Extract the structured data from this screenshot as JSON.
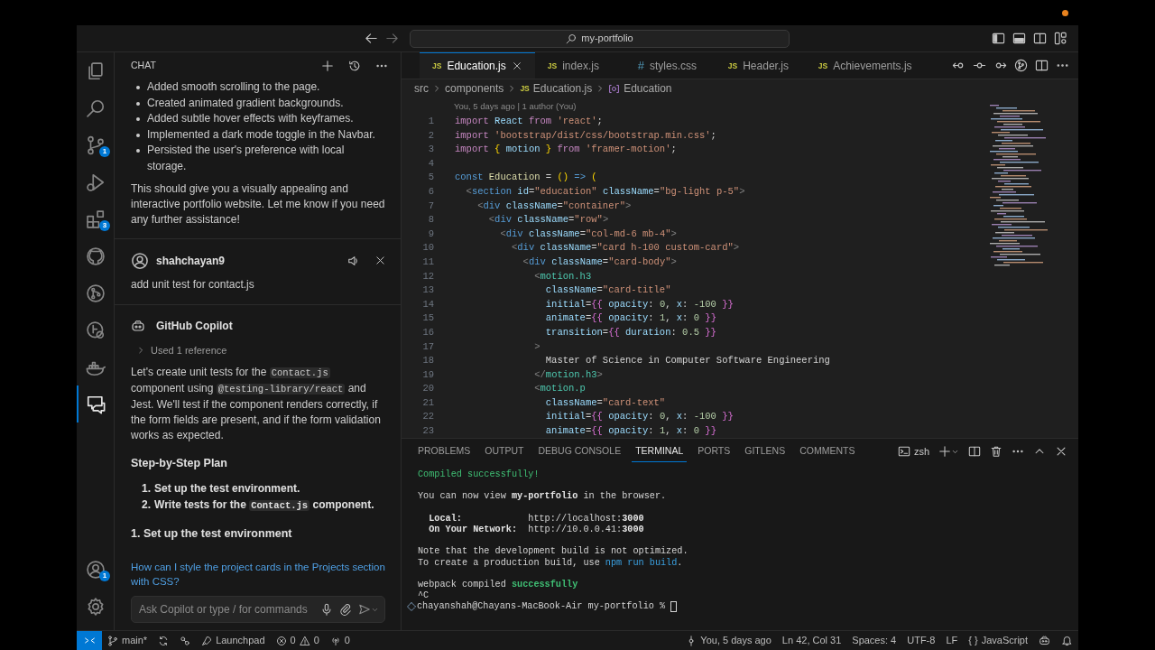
{
  "title_bar": {
    "search": "my-portfolio"
  },
  "activity_bar": {
    "top": [
      {
        "selected": false
      },
      {
        "selected": false
      },
      {
        "selected": false,
        "badge": "1"
      },
      {
        "selected": false
      },
      {
        "selected": false,
        "badge": "3"
      },
      {
        "selected": false
      },
      {
        "selected": false
      },
      {
        "selected": false
      },
      {
        "selected": false
      },
      {
        "selected": true
      }
    ],
    "bottom": [
      {
        "selected": false,
        "badge": "1"
      },
      {
        "selected": false
      }
    ]
  },
  "chat": {
    "title": "CHAT",
    "items": [
      {
        "kind": "bullets",
        "items": [
          "Added smooth scrolling to the page.",
          "Created animated gradient backgrounds.",
          "Added subtle hover effects with keyframes.",
          "Implemented a dark mode toggle in the Navbar.",
          "Persisted the user's preference with local storage."
        ]
      },
      {
        "kind": "paragraph",
        "segments": [
          {
            "text": "This should give you a visually appealing and interactive portfolio website. Let me know if you need any further assistance!"
          }
        ]
      },
      {
        "kind": "user",
        "author": "shahchayan9",
        "text": "add unit test for contact.js"
      },
      {
        "kind": "assistant",
        "author": "GitHub Copilot",
        "reference": "Used 1 reference"
      },
      {
        "kind": "paragraph",
        "segments": [
          {
            "text": "Let's create unit tests for the "
          },
          {
            "text": "Contact.js",
            "code": true
          },
          {
            "text": " component using "
          },
          {
            "text": "@testing-library/react",
            "code": true
          },
          {
            "text": " and Jest. We'll test if the component renders correctly, if the form fields are present, and if the form validation works as expected."
          }
        ]
      },
      {
        "kind": "heading",
        "text": "Step-by-Step Plan"
      },
      {
        "kind": "numbered",
        "items": [
          {
            "number": "1.",
            "segments": [
              {
                "text": "Set up the test environment."
              }
            ]
          },
          {
            "number": "2.",
            "segments": [
              {
                "text": "Write tests for the "
              },
              {
                "text": "Contact.js",
                "code": true
              },
              {
                "text": " component."
              }
            ]
          }
        ]
      },
      {
        "kind": "heading",
        "text": "1. Set up the test environment"
      }
    ],
    "suggestion": "How can I style the project cards in the Projects section with CSS?",
    "input": {
      "placeholder": "Ask Copilot or type / for commands"
    }
  },
  "editor": {
    "tabs": [
      {
        "kind": "js",
        "icon_text": "JS",
        "label": "Education.js",
        "selected": true
      },
      {
        "kind": "js",
        "icon_text": "JS",
        "label": "index.js",
        "selected": false
      },
      {
        "kind": "css",
        "icon_text": "#",
        "label": "styles.css",
        "selected": false
      },
      {
        "kind": "js",
        "icon_text": "JS",
        "label": "Header.js",
        "selected": false
      },
      {
        "kind": "js",
        "icon_text": "JS",
        "label": "Achievements.js",
        "selected": false
      }
    ],
    "breadcrumb": [
      {
        "kind": "folder",
        "text": "src"
      },
      {
        "kind": "folder",
        "text": "components"
      },
      {
        "kind": "file",
        "icon_text": "JS",
        "text": "Education.js"
      },
      {
        "kind": "symbol",
        "text": "Education"
      }
    ],
    "blame": "You, 5 days ago | 1 author (You)",
    "lines": [
      {
        "number": "1",
        "tokens": [
          {
            "kind": "kw",
            "text": "import "
          },
          {
            "kind": "var",
            "text": "React "
          },
          {
            "kind": "kw",
            "text": "from "
          },
          {
            "kind": "str",
            "text": "'react'"
          },
          {
            "kind": "p",
            "text": ";"
          }
        ]
      },
      {
        "number": "2",
        "tokens": [
          {
            "kind": "kw",
            "text": "import "
          },
          {
            "kind": "str",
            "text": "'bootstrap/dist/css/bootstrap.min.css'"
          },
          {
            "kind": "p",
            "text": ";"
          }
        ]
      },
      {
        "number": "3",
        "tokens": [
          {
            "kind": "kw",
            "text": "import "
          },
          {
            "kind": "b1",
            "text": "{ "
          },
          {
            "kind": "var",
            "text": "motion "
          },
          {
            "kind": "b1",
            "text": "} "
          },
          {
            "kind": "kw",
            "text": "from "
          },
          {
            "kind": "str",
            "text": "'framer-motion'"
          },
          {
            "kind": "p",
            "text": ";"
          }
        ]
      },
      {
        "number": "4"
      },
      {
        "number": "5",
        "tokens": [
          {
            "kind": "st",
            "text": "const "
          },
          {
            "kind": "fn",
            "text": "Education "
          },
          {
            "kind": "p",
            "text": "= "
          },
          {
            "kind": "b1",
            "text": "() "
          },
          {
            "kind": "st",
            "text": "=> "
          },
          {
            "kind": "b1",
            "text": "("
          }
        ]
      },
      {
        "number": "6",
        "tokens": [
          {
            "kind": "tp",
            "text": "  <"
          },
          {
            "kind": "tag",
            "text": "section "
          },
          {
            "kind": "attr",
            "text": "id"
          },
          {
            "kind": "p",
            "text": "="
          },
          {
            "kind": "str",
            "text": "\"education\" "
          },
          {
            "kind": "attr",
            "text": "className"
          },
          {
            "kind": "p",
            "text": "="
          },
          {
            "kind": "str",
            "text": "\"bg-light p-5\""
          },
          {
            "kind": "tp",
            "text": ">"
          }
        ]
      },
      {
        "number": "7",
        "tokens": [
          {
            "kind": "tp",
            "text": "    <"
          },
          {
            "kind": "tag",
            "text": "div "
          },
          {
            "kind": "attr",
            "text": "className"
          },
          {
            "kind": "p",
            "text": "="
          },
          {
            "kind": "str",
            "text": "\"container\""
          },
          {
            "kind": "tp",
            "text": ">"
          }
        ]
      },
      {
        "number": "8",
        "tokens": [
          {
            "kind": "tp",
            "text": "      <"
          },
          {
            "kind": "tag",
            "text": "div "
          },
          {
            "kind": "attr",
            "text": "className"
          },
          {
            "kind": "p",
            "text": "="
          },
          {
            "kind": "str",
            "text": "\"row\""
          },
          {
            "kind": "tp",
            "text": ">"
          }
        ]
      },
      {
        "number": "9",
        "tokens": [
          {
            "kind": "tp",
            "text": "        <"
          },
          {
            "kind": "tag",
            "text": "div "
          },
          {
            "kind": "attr",
            "text": "className"
          },
          {
            "kind": "p",
            "text": "="
          },
          {
            "kind": "str",
            "text": "\"col-md-6 mb-4\""
          },
          {
            "kind": "tp",
            "text": ">"
          }
        ]
      },
      {
        "number": "10",
        "tokens": [
          {
            "kind": "tp",
            "text": "          <"
          },
          {
            "kind": "tag",
            "text": "div "
          },
          {
            "kind": "attr",
            "text": "className"
          },
          {
            "kind": "p",
            "text": "="
          },
          {
            "kind": "str",
            "text": "\"card h-100 custom-card\""
          },
          {
            "kind": "tp",
            "text": ">"
          }
        ]
      },
      {
        "number": "11",
        "tokens": [
          {
            "kind": "tp",
            "text": "            <"
          },
          {
            "kind": "tag",
            "text": "div "
          },
          {
            "kind": "attr",
            "text": "className"
          },
          {
            "kind": "p",
            "text": "="
          },
          {
            "kind": "str",
            "text": "\"card-body\""
          },
          {
            "kind": "tp",
            "text": ">"
          }
        ]
      },
      {
        "number": "12",
        "tokens": [
          {
            "kind": "tp",
            "text": "              <"
          },
          {
            "kind": "comp",
            "text": "motion.h3"
          }
        ]
      },
      {
        "number": "13",
        "tokens": [
          {
            "kind": "attr",
            "text": "                className"
          },
          {
            "kind": "p",
            "text": "="
          },
          {
            "kind": "str",
            "text": "\"card-title\""
          }
        ]
      },
      {
        "number": "14",
        "tokens": [
          {
            "kind": "attr",
            "text": "                initial"
          },
          {
            "kind": "p",
            "text": "="
          },
          {
            "kind": "b2",
            "text": "{{ "
          },
          {
            "kind": "var",
            "text": "opacity"
          },
          {
            "kind": "p",
            "text": ": "
          },
          {
            "kind": "num",
            "text": "0"
          },
          {
            "kind": "p",
            "text": ", "
          },
          {
            "kind": "var",
            "text": "x"
          },
          {
            "kind": "p",
            "text": ": "
          },
          {
            "kind": "num",
            "text": "-100 "
          },
          {
            "kind": "b2",
            "text": "}}"
          }
        ]
      },
      {
        "number": "15",
        "tokens": [
          {
            "kind": "attr",
            "text": "                animate"
          },
          {
            "kind": "p",
            "text": "="
          },
          {
            "kind": "b2",
            "text": "{{ "
          },
          {
            "kind": "var",
            "text": "opacity"
          },
          {
            "kind": "p",
            "text": ": "
          },
          {
            "kind": "num",
            "text": "1"
          },
          {
            "kind": "p",
            "text": ", "
          },
          {
            "kind": "var",
            "text": "x"
          },
          {
            "kind": "p",
            "text": ": "
          },
          {
            "kind": "num",
            "text": "0 "
          },
          {
            "kind": "b2",
            "text": "}}"
          }
        ]
      },
      {
        "number": "16",
        "tokens": [
          {
            "kind": "attr",
            "text": "                transition"
          },
          {
            "kind": "p",
            "text": "="
          },
          {
            "kind": "b2",
            "text": "{{ "
          },
          {
            "kind": "var",
            "text": "duration"
          },
          {
            "kind": "p",
            "text": ": "
          },
          {
            "kind": "num",
            "text": "0.5 "
          },
          {
            "kind": "b2",
            "text": "}}"
          }
        ]
      },
      {
        "number": "17",
        "tokens": [
          {
            "kind": "tp",
            "text": "              >"
          }
        ]
      },
      {
        "number": "18",
        "tokens": [
          {
            "kind": "p",
            "text": "                Master of Science in Computer Software Engineering"
          }
        ]
      },
      {
        "number": "19",
        "tokens": [
          {
            "kind": "tp",
            "text": "              </"
          },
          {
            "kind": "comp",
            "text": "motion.h3"
          },
          {
            "kind": "tp",
            "text": ">"
          }
        ]
      },
      {
        "number": "20",
        "tokens": [
          {
            "kind": "tp",
            "text": "              <"
          },
          {
            "kind": "comp",
            "text": "motion.p"
          }
        ]
      },
      {
        "number": "21",
        "tokens": [
          {
            "kind": "attr",
            "text": "                className"
          },
          {
            "kind": "p",
            "text": "="
          },
          {
            "kind": "str",
            "text": "\"card-text\""
          }
        ]
      },
      {
        "number": "22",
        "tokens": [
          {
            "kind": "attr",
            "text": "                initial"
          },
          {
            "kind": "p",
            "text": "="
          },
          {
            "kind": "b2",
            "text": "{{ "
          },
          {
            "kind": "var",
            "text": "opacity"
          },
          {
            "kind": "p",
            "text": ": "
          },
          {
            "kind": "num",
            "text": "0"
          },
          {
            "kind": "p",
            "text": ", "
          },
          {
            "kind": "var",
            "text": "x"
          },
          {
            "kind": "p",
            "text": ": "
          },
          {
            "kind": "num",
            "text": "-100 "
          },
          {
            "kind": "b2",
            "text": "}}"
          }
        ]
      },
      {
        "number": "23",
        "tokens": [
          {
            "kind": "attr",
            "text": "                animate"
          },
          {
            "kind": "p",
            "text": "="
          },
          {
            "kind": "b2",
            "text": "{{ "
          },
          {
            "kind": "var",
            "text": "opacity"
          },
          {
            "kind": "p",
            "text": ": "
          },
          {
            "kind": "num",
            "text": "1"
          },
          {
            "kind": "p",
            "text": ", "
          },
          {
            "kind": "var",
            "text": "x"
          },
          {
            "kind": "p",
            "text": ": "
          },
          {
            "kind": "num",
            "text": "0 "
          },
          {
            "kind": "b2",
            "text": "}}"
          }
        ]
      }
    ]
  },
  "panel": {
    "tabs": [
      {
        "label": "PROBLEMS",
        "selected": false
      },
      {
        "label": "OUTPUT",
        "selected": false
      },
      {
        "label": "DEBUG CONSOLE",
        "selected": false
      },
      {
        "label": "TERMINAL",
        "selected": true
      },
      {
        "label": "PORTS",
        "selected": false
      },
      {
        "label": "GITLENS",
        "selected": false
      },
      {
        "label": "COMMENTS",
        "selected": false
      }
    ],
    "shell": "zsh",
    "terminal": [
      {
        "kind": "text",
        "segments": [
          {
            "kind": "green",
            "text": "Compiled successfully!"
          }
        ]
      },
      {
        "kind": "blank"
      },
      {
        "kind": "text",
        "segments": [
          {
            "kind": "plain",
            "text": "You can now view "
          },
          {
            "kind": "bold",
            "text": "my-portfolio"
          },
          {
            "kind": "plain",
            "text": " in the browser."
          }
        ]
      },
      {
        "kind": "blank"
      },
      {
        "kind": "text",
        "segments": [
          {
            "kind": "bold",
            "text": "  Local:"
          },
          {
            "kind": "plain",
            "text": "            http://localhost:"
          },
          {
            "kind": "bold",
            "text": "3000"
          }
        ]
      },
      {
        "kind": "text",
        "segments": [
          {
            "kind": "bold",
            "text": "  On Your Network:"
          },
          {
            "kind": "plain",
            "text": "  http://10.0.0.41:"
          },
          {
            "kind": "bold",
            "text": "3000"
          }
        ]
      },
      {
        "kind": "blank"
      },
      {
        "kind": "text",
        "segments": [
          {
            "kind": "plain",
            "text": "Note that the development build is not optimized."
          }
        ]
      },
      {
        "kind": "text",
        "segments": [
          {
            "kind": "plain",
            "text": "To create a production build, use "
          },
          {
            "kind": "link",
            "text": "npm run build"
          },
          {
            "kind": "plain",
            "text": "."
          }
        ]
      },
      {
        "kind": "blank"
      },
      {
        "kind": "text",
        "segments": [
          {
            "kind": "plain",
            "text": "webpack compiled "
          },
          {
            "kind": "boldgreen",
            "text": "successfully"
          }
        ]
      },
      {
        "kind": "text",
        "segments": [
          {
            "kind": "plain",
            "text": "^C"
          }
        ]
      }
    ],
    "prompt": "chayanshah@Chayans-MacBook-Air my-portfolio % "
  },
  "status_bar": {
    "branch": "main*",
    "launchpad": "Launchpad",
    "errors": "0",
    "warnings": "0",
    "ports": "0",
    "blame": "You, 5 days ago",
    "cursor": "Ln 42, Col 31",
    "indent": "Spaces: 4",
    "encoding": "UTF-8",
    "eol": "LF",
    "language_icon": "{ }",
    "language": "JavaScript"
  }
}
